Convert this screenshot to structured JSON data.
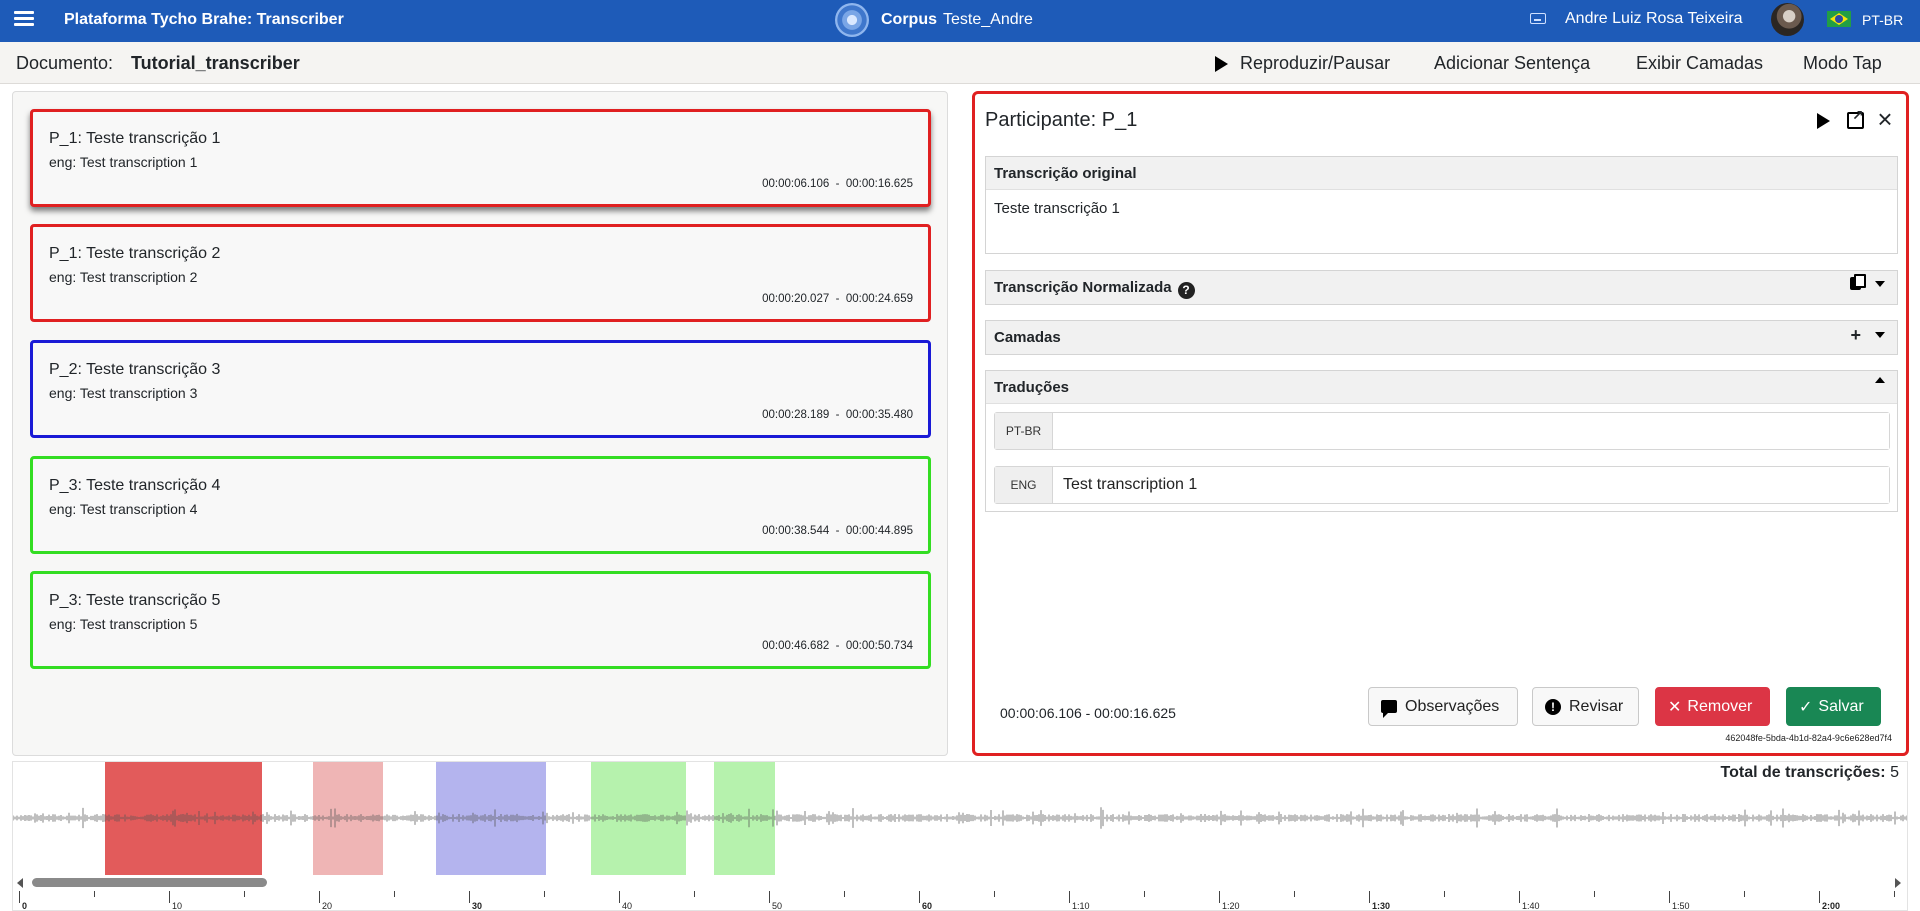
{
  "navbar": {
    "app_title": "Plataforma Tycho Brahe: Transcriber",
    "corpus_label": "Corpus",
    "corpus_name": "Teste_Andre",
    "user_name": "Andre Luiz Rosa Teixeira",
    "language": "PT-BR"
  },
  "document": {
    "label": "Documento:",
    "name": "Tutorial_transcriber",
    "actions": {
      "play_pause": "Reproduzir/Pausar",
      "add_sentence": "Adicionar Sentença",
      "show_layers": "Exibir Camadas",
      "tap_mode": "Modo Tap"
    }
  },
  "transcriptions": [
    {
      "title": "P_1: Teste transcrição 1",
      "translation": "eng: Test transcription 1",
      "time": "00:00:06.106  -  00:00:16.625",
      "color": "#e02021",
      "selected": true
    },
    {
      "title": "P_1: Teste transcrição 2",
      "translation": "eng: Test transcription 2",
      "time": "00:00:20.027  -  00:00:24.659",
      "color": "#e02021",
      "selected": false
    },
    {
      "title": "P_2: Teste transcrição 3",
      "translation": "eng: Test transcription 3",
      "time": "00:00:28.189  -  00:00:35.480",
      "color": "#1a1ad6",
      "selected": false
    },
    {
      "title": "P_3: Teste transcrição 4",
      "translation": "eng: Test transcription 4",
      "time": "00:00:38.544  -  00:00:44.895",
      "color": "#33dd22",
      "selected": false
    },
    {
      "title": "P_3: Teste transcrição 5",
      "translation": "eng: Test transcription 5",
      "time": "00:00:46.682  -  00:00:50.734",
      "color": "#33dd22",
      "selected": false
    }
  ],
  "editor": {
    "participant_label": "Participante:",
    "participant": "P_1",
    "original_header": "Transcrição original",
    "original_text": "Teste transcrição 1",
    "normalized_header": "Transcrição Normalizada",
    "layers_header": "Camadas",
    "translations_header": "Traduções",
    "translation_rows": [
      {
        "lang": "PT-BR",
        "value": ""
      },
      {
        "lang": "ENG",
        "value": "Test transcription 1"
      }
    ],
    "time_range": "00:00:06.106 - 00:00:16.625",
    "buttons": {
      "notes": "Observações",
      "review": "Revisar",
      "remove": "Remover",
      "save": "Salvar"
    },
    "uuid": "462048fe-5bda-4b1d-82a4-9c6e628ed7f4"
  },
  "waveform": {
    "total_label": "Total de transcrições:",
    "total_count": "5",
    "ruler_labels": [
      "0",
      "10",
      "20",
      "30",
      "40",
      "50",
      "60",
      "1:10",
      "1:20",
      "1:30",
      "1:40",
      "1:50",
      "2:00"
    ]
  },
  "colors": {
    "navbar": "#1e5bb8",
    "selected_border": "#e02021",
    "p1": "#e02021",
    "p2": "#1a1ad6",
    "p3": "#33dd22"
  }
}
